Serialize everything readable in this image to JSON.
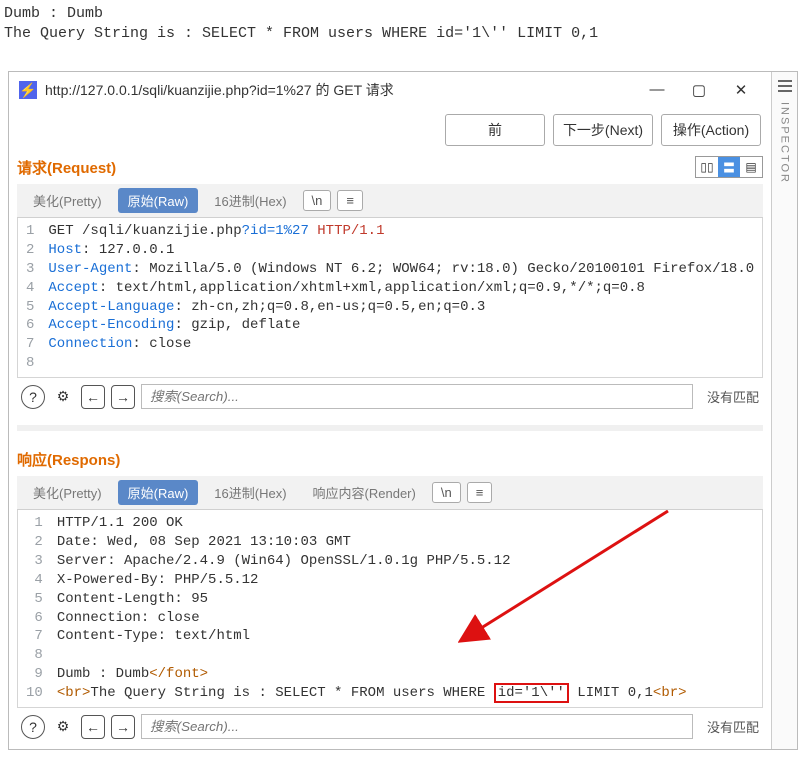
{
  "preamble": {
    "line1": "Dumb : Dumb",
    "line2": "The Query String is : SELECT * FROM users WHERE id='1\\'' LIMIT 0,1"
  },
  "window": {
    "title": "http://127.0.0.1/sqli/kuanzijie.php?id=1%27 的 GET 请求",
    "buttons": {
      "min": "—",
      "max": "▢",
      "close": "✕"
    }
  },
  "topbar": {
    "prev": "前",
    "next": "下一步(Next)",
    "action": "操作(Action)"
  },
  "tabs": {
    "pretty": "美化(Pretty)",
    "raw": "原始(Raw)",
    "hex": "16进制(Hex)",
    "render": "响应内容(Render)",
    "nl": "\\n",
    "menu": "≡"
  },
  "panes": {
    "request": {
      "title": "请求(Request)",
      "lines": [
        {
          "plain": "GET /sqli/kuanzijie.php",
          "q": "?id=1%27",
          "tail": " HTTP/1.1"
        },
        {
          "k": "Host",
          "v": "127.0.0.1"
        },
        {
          "k": "User-Agent",
          "v": "Mozilla/5.0 (Windows NT 6.2; WOW64; rv:18.0) Gecko/20100101 Firefox/18.0"
        },
        {
          "k": "Accept",
          "v": "text/html,application/xhtml+xml,application/xml;q=0.9,*/*;q=0.8"
        },
        {
          "k": "Accept-Language",
          "v": "zh-cn,zh;q=0.8,en-us;q=0.5,en;q=0.3"
        },
        {
          "k": "Accept-Encoding",
          "v": "gzip, deflate"
        },
        {
          "k": "Connection",
          "v": "close"
        },
        {
          "plain": ""
        }
      ]
    },
    "response": {
      "title": "响应(Respons)",
      "lines_pre": [
        "HTTP/1.1 200 OK",
        "Date: Wed, 08 Sep 2021 13:10:03 GMT",
        "Server: Apache/2.4.9 (Win64) OpenSSL/1.0.1g PHP/5.5.12",
        "X-Powered-By: PHP/5.5.12",
        "Content-Length: 95",
        "Connection: close",
        "Content-Type: text/html",
        ""
      ],
      "l9_text": "Dumb : Dumb",
      "l9_tag": "</font>",
      "l10_pre": "The Query String is : SELECT * FROM users WHERE ",
      "l10_box": "id='1\\''",
      "l10_post": " LIMIT 0,1",
      "br": "<br>"
    }
  },
  "search": {
    "placeholder": "搜索(Search)...",
    "nores": "没有匹配",
    "help": "?",
    "gear": "⚙",
    "left": "←",
    "right": "→"
  },
  "inspector": {
    "label": "INSPECTOR"
  },
  "view": {
    "a": "▯▯",
    "b": "〓",
    "c": "▤"
  }
}
